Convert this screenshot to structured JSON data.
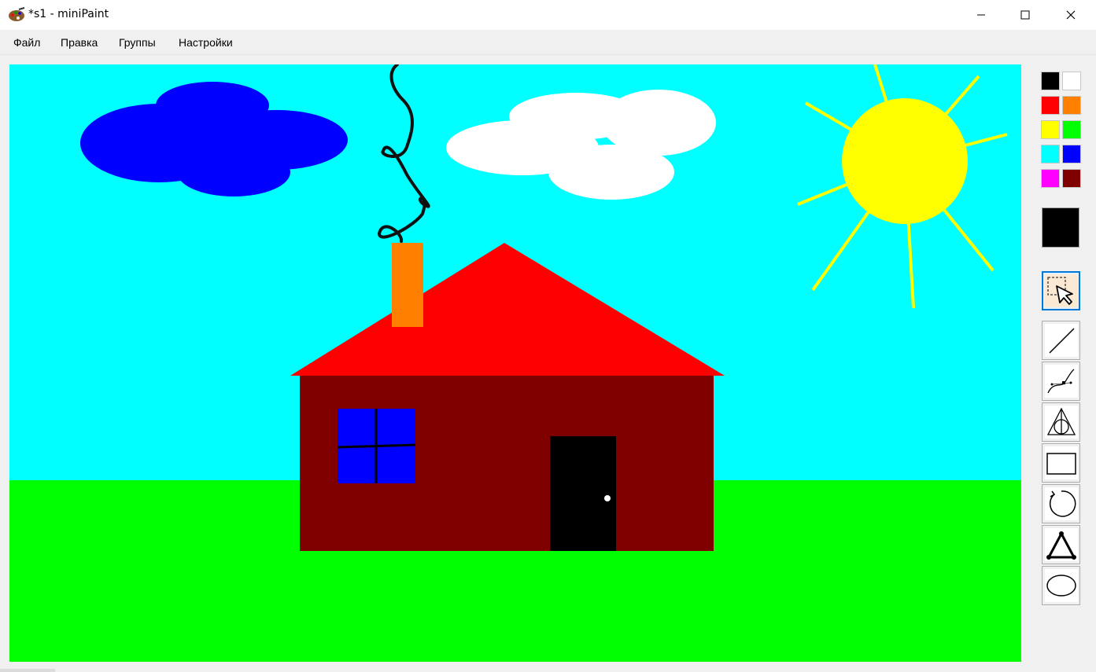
{
  "window": {
    "title": "*s1 - miniPaint"
  },
  "menu": {
    "items": [
      "Файл",
      "Правка",
      "Группы",
      "Настройки"
    ]
  },
  "palette": {
    "colors": [
      "#000000",
      "#ffffff",
      "#ff0000",
      "#ff8000",
      "#ffff00",
      "#00ff00",
      "#00ffff",
      "#0000ff",
      "#ff00ff",
      "#800000"
    ],
    "current": "#000000"
  },
  "tools": [
    {
      "name": "select-icon",
      "active": true
    },
    {
      "name": "line-icon",
      "active": false
    },
    {
      "name": "bezier-icon",
      "active": false
    },
    {
      "name": "deathly-hallows-icon",
      "active": false
    },
    {
      "name": "rectangle-icon",
      "active": false
    },
    {
      "name": "circle-icon",
      "active": false
    },
    {
      "name": "triangle-icon",
      "active": false
    },
    {
      "name": "ellipse-icon",
      "active": false
    }
  ],
  "drawing": {
    "sky": "#00ffff",
    "grass": "#00ff00",
    "roof": "#ff0000",
    "walls": "#800000",
    "chimney": "#ff8000",
    "window": "#0000ff",
    "door": "#000000",
    "sun": "#ffff00",
    "cloud_dark": "#0000ff",
    "cloud_light": "#ffffff"
  }
}
